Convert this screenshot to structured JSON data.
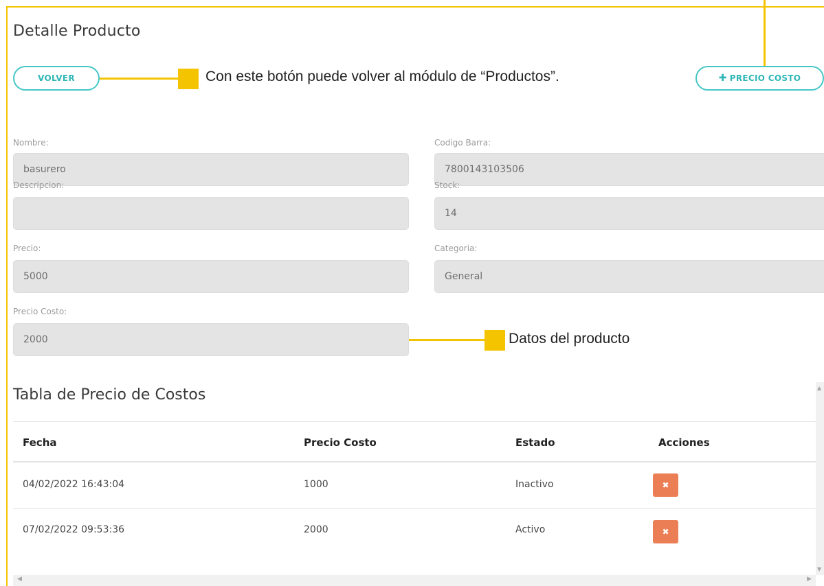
{
  "page": {
    "title": "Detalle Producto"
  },
  "buttons": {
    "back_label": "VOLVER",
    "add_cost_label": "PRECIO COSTO",
    "add_cost_icon": "plus-icon"
  },
  "annotations": {
    "back_note": "Con este botón puede volver al módulo de “Productos”.",
    "data_note": "Datos del producto"
  },
  "form": {
    "nombre": {
      "label": "Nombre:",
      "value": "basurero"
    },
    "codigo_barra": {
      "label": "Codigo Barra:",
      "value": "7800143103506"
    },
    "descripcion": {
      "label": "Descripcion:",
      "value": ""
    },
    "stock": {
      "label": "Stock:",
      "value": "14"
    },
    "precio": {
      "label": "Precio:",
      "value": "5000"
    },
    "categoria": {
      "label": "Categoria:",
      "value": "General"
    },
    "precio_costo": {
      "label": "Precio Costo:",
      "value": "2000"
    }
  },
  "table": {
    "title": "Tabla de Precio de Costos",
    "headers": [
      "Fecha",
      "Precio Costo",
      "Estado",
      "Acciones"
    ],
    "rows": [
      {
        "fecha": "04/02/2022 16:43:04",
        "precio_costo": "1000",
        "estado": "Inactivo",
        "action_icon": "close-icon"
      },
      {
        "fecha": "07/02/2022 09:53:36",
        "precio_costo": "2000",
        "estado": "Activo",
        "action_icon": "close-icon"
      }
    ]
  },
  "colors": {
    "accent": "#45c6c6",
    "highlight": "#f5c400",
    "danger": "#ec7e55",
    "input_bg": "#e4e4e4"
  }
}
